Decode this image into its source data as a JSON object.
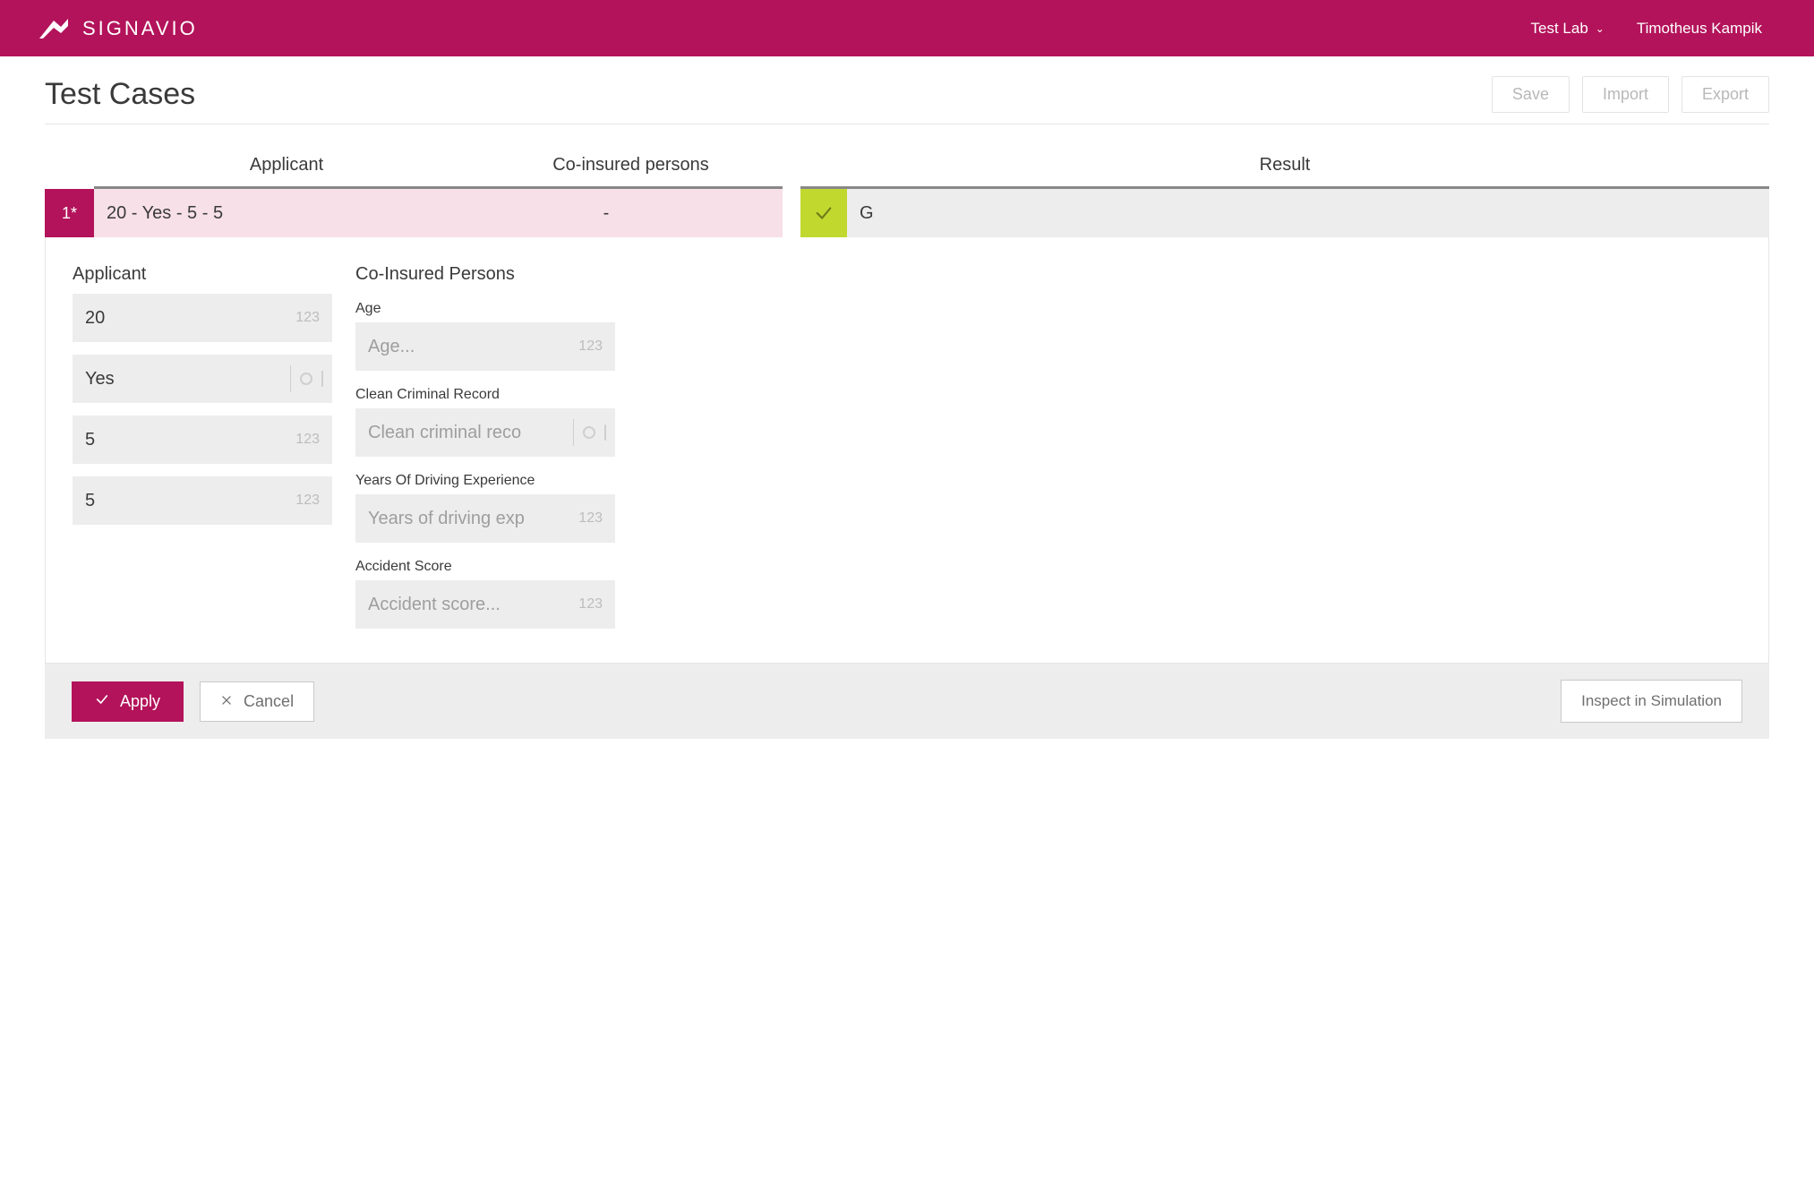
{
  "brand": {
    "name": "SIGNAVIO"
  },
  "topbar": {
    "nav_label": "Test Lab",
    "user_name": "Timotheus Kampik"
  },
  "header": {
    "title": "Test Cases",
    "save_label": "Save",
    "import_label": "Import",
    "export_label": "Export"
  },
  "table": {
    "columns": {
      "applicant": "Applicant",
      "coinsured": "Co-insured persons",
      "result": "Result"
    },
    "row": {
      "num": "1*",
      "applicant_summary": "20 - Yes - 5 - 5",
      "coinsured_summary": "-",
      "result_value": "G"
    }
  },
  "detail": {
    "applicant": {
      "title": "Applicant",
      "fields": {
        "age": {
          "value": "20",
          "hint": "123"
        },
        "clean_record": {
          "value": "Yes"
        },
        "years_exp": {
          "value": "5",
          "hint": "123"
        },
        "accident": {
          "value": "5",
          "hint": "123"
        }
      }
    },
    "coinsured": {
      "title": "Co-Insured Persons",
      "age": {
        "label": "Age",
        "placeholder": "Age...",
        "hint": "123"
      },
      "clean_record": {
        "label": "Clean Criminal Record",
        "placeholder": "Clean criminal reco"
      },
      "years_exp": {
        "label": "Years Of Driving Experience",
        "placeholder": "Years of driving exp",
        "hint": "123"
      },
      "accident": {
        "label": "Accident Score",
        "placeholder": "Accident score...",
        "hint": "123"
      }
    }
  },
  "footer": {
    "apply": "Apply",
    "cancel": "Cancel",
    "inspect": "Inspect in Simulation"
  }
}
